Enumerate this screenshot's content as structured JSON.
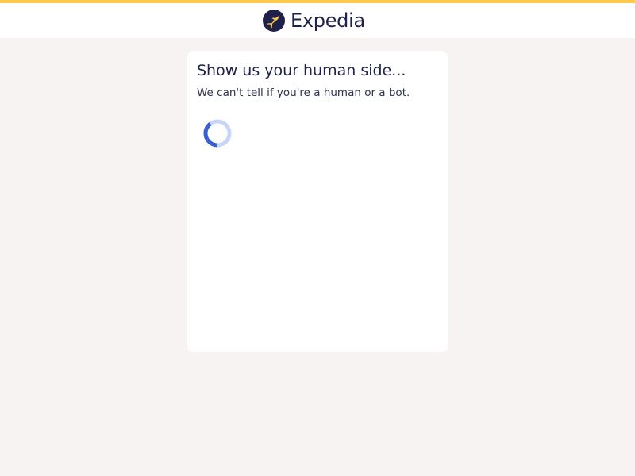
{
  "brand": {
    "name": "Expedia",
    "accent_color": "#fec84a",
    "logo_color": "#1e2148",
    "logo_icon_color": "#fec84a"
  },
  "challenge": {
    "title": "Show us your human side...",
    "subtitle": "We can't tell if you're a human or a bot."
  },
  "spinner": {
    "icon": "loading-spinner-icon",
    "track_color": "#c9d5f7",
    "arc_color": "#3a5fd0"
  },
  "colors": {
    "page_background": "#f6f3f2",
    "card_background": "#ffffff",
    "text_primary": "#1e2148"
  }
}
